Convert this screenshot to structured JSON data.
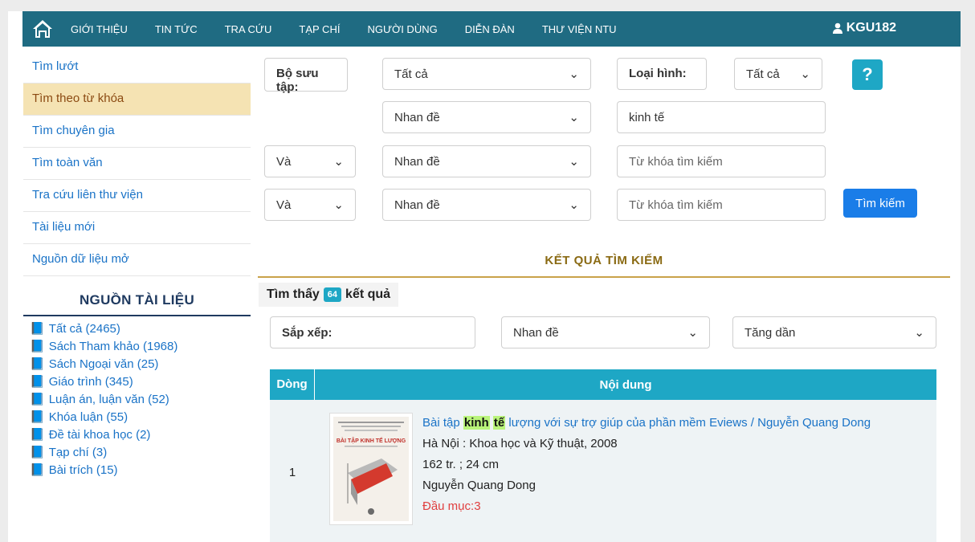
{
  "nav": {
    "items": [
      "GIỚI THIỆU",
      "TIN TỨC",
      "TRA CỨU",
      "TẠP CHÍ",
      "NGƯỜI DÙNG",
      "DIỄN ĐÀN",
      "THƯ VIỆN NTU"
    ],
    "user": "KGU182"
  },
  "sidebar": {
    "items": [
      "Tìm lướt",
      "Tìm theo từ khóa",
      "Tìm chuyên gia",
      "Tìm toàn văn",
      "Tra cứu liên thư viện",
      "Tài liệu mới",
      "Nguồn dữ liệu mở"
    ],
    "sources_title": "NGUỒN TÀI LIỆU",
    "sources": [
      "Tất cả (2465)",
      "Sách Tham khảo (1968)",
      "Sách Ngoại văn (25)",
      "Giáo trình (345)",
      "Luận án, luận văn (52)",
      "Khóa luận (55)",
      "Đề tài khoa học (2)",
      "Tạp chí (3)",
      "Bài trích (15)"
    ]
  },
  "form": {
    "collection_label": "Bộ sưu tập:",
    "collection_value": "Tất cả",
    "type_label": "Loại hình:",
    "type_value": "Tất cả",
    "help": "?",
    "row1_field": "Nhan đề",
    "row1_value": "kinh tế",
    "row2_op": "Và",
    "row2_field": "Nhan đề",
    "row2_placeholder": "Từ khóa tìm kiếm",
    "row3_op": "Và",
    "row3_field": "Nhan đề",
    "row3_placeholder": "Từ khóa tìm kiếm",
    "search_button": "Tìm kiếm"
  },
  "results": {
    "title": "KẾT QUẢ TÌM KIẾM",
    "found_prefix": "Tìm thấy",
    "count": "64",
    "found_suffix": "kết quả",
    "sort_label": "Sắp xếp:",
    "sort_field": "Nhan đề",
    "sort_order": "Tăng dần",
    "col_row": "Dòng",
    "col_content": "Nội dung",
    "rows": [
      {
        "num": "1",
        "title_before": "Bài tập",
        "highlight1": "kinh",
        "highlight2": "tế",
        "title_after": "lượng với sự trợ giúp của phần mềm Eviews / Nguyễn Quang Dong",
        "publisher": "Hà Nội : Khoa học và Kỹ thuật, 2008",
        "physical": "162 tr. ; 24 cm",
        "author": "Nguyễn Quang Dong",
        "muc": "Đầu mục:3",
        "cover_title": "BÀI TẬP KINH TẾ LƯỢNG"
      }
    ]
  }
}
